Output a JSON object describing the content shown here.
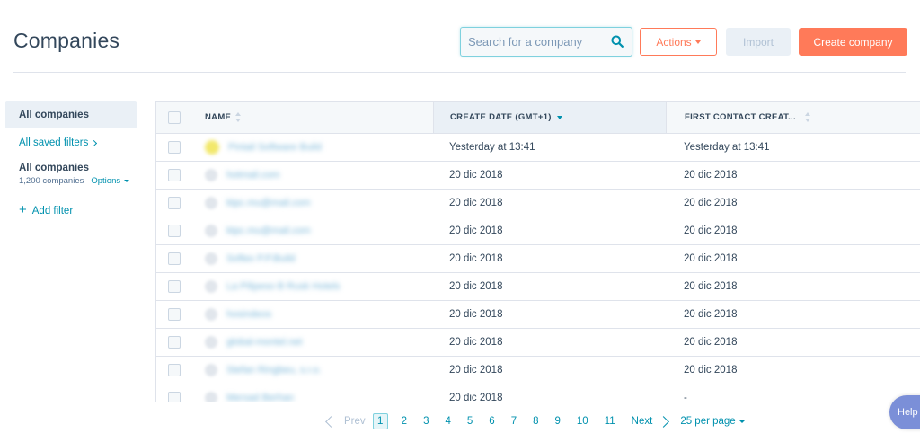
{
  "header": {
    "title": "Companies",
    "search_placeholder": "Search for a company",
    "actions_label": "Actions",
    "import_label": "Import",
    "create_label": "Create company"
  },
  "sidebar": {
    "active_view": "All companies",
    "saved_filters_label": "All saved filters",
    "view_name": "All companies",
    "view_count": "1,200 companies",
    "options_label": "Options",
    "add_filter_label": "Add filter"
  },
  "table": {
    "columns": [
      {
        "key": "name",
        "label": "NAME"
      },
      {
        "key": "create_date",
        "label": "CREATE DATE (GMT+1)"
      },
      {
        "key": "first_contact",
        "label": "FIRST CONTACT CREAT..."
      }
    ],
    "rows": [
      {
        "name": "Pintail Software Build",
        "create_date": "Yesterday at 13:41",
        "first_contact": "Yesterday at 13:41"
      },
      {
        "name": "hotmail.com",
        "create_date": "20 dic 2018",
        "first_contact": "20 dic 2018"
      },
      {
        "name": "ktpc.mu@mail.com",
        "create_date": "20 dic 2018",
        "first_contact": "20 dic 2018"
      },
      {
        "name": "ktpc.mu@mail.com",
        "create_date": "20 dic 2018",
        "first_contact": "20 dic 2018"
      },
      {
        "name": "Softex P.P.Build",
        "create_date": "20 dic 2018",
        "first_contact": "20 dic 2018"
      },
      {
        "name": "La Pilipeso B Rusk Hotels",
        "create_date": "20 dic 2018",
        "first_contact": "20 dic 2018"
      },
      {
        "name": "hosindeos",
        "create_date": "20 dic 2018",
        "first_contact": "20 dic 2018"
      },
      {
        "name": "global-montel.net",
        "create_date": "20 dic 2018",
        "first_contact": "20 dic 2018"
      },
      {
        "name": "Stefan Ringbeu, s.r.o.",
        "create_date": "20 dic 2018",
        "first_contact": "20 dic 2018"
      },
      {
        "name": "Mersad Berhan",
        "create_date": "20 dic 2018",
        "first_contact": "-"
      }
    ]
  },
  "pagination": {
    "prev_label": "Prev",
    "pages": [
      "1",
      "2",
      "3",
      "4",
      "5",
      "6",
      "7",
      "8",
      "9",
      "10",
      "11"
    ],
    "current_page": "1",
    "next_label": "Next",
    "per_page_label": "25 per page"
  },
  "help_label": "Help",
  "colors": {
    "accent": "#ff7a59",
    "link": "#0091ae",
    "text": "#33475b",
    "border": "#dfe3eb",
    "help": "#7b8fd8"
  }
}
